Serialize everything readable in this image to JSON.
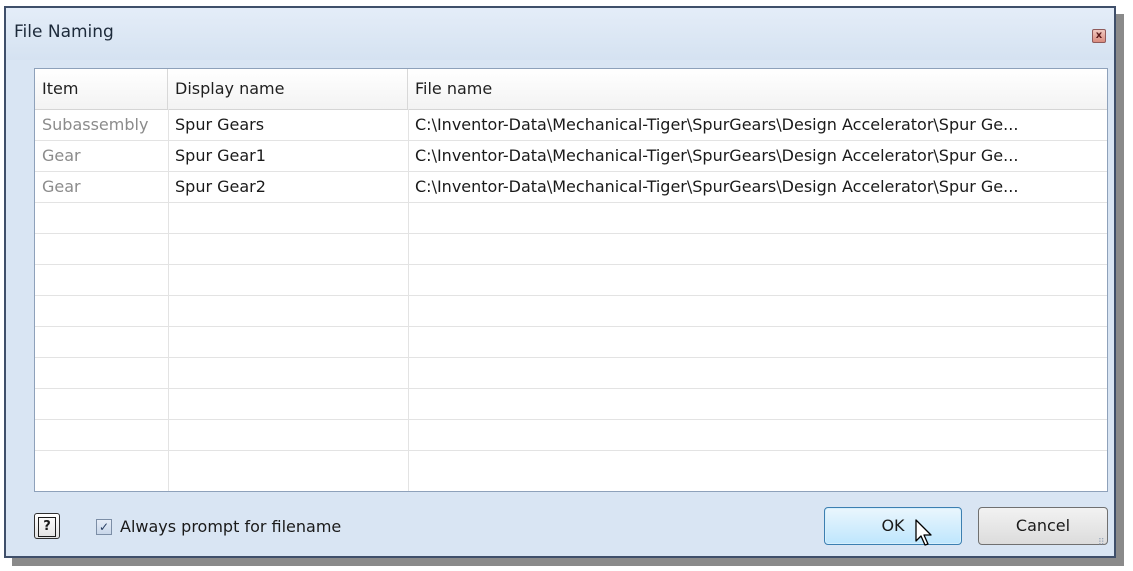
{
  "dialog": {
    "title": "File Naming",
    "close_label": "x"
  },
  "table": {
    "columns": [
      "Item",
      "Display name",
      "File name"
    ],
    "rows": [
      {
        "item": "Subassembly",
        "display_name": "Spur Gears",
        "file_name": "C:\\Inventor-Data\\Mechanical-Tiger\\SpurGears\\Design Accelerator\\Spur Ge..."
      },
      {
        "item": "Gear",
        "display_name": "Spur Gear1",
        "file_name": "C:\\Inventor-Data\\Mechanical-Tiger\\SpurGears\\Design Accelerator\\Spur Ge..."
      },
      {
        "item": "Gear",
        "display_name": "Spur Gear2",
        "file_name": "C:\\Inventor-Data\\Mechanical-Tiger\\SpurGears\\Design Accelerator\\Spur Ge..."
      }
    ],
    "empty_row_count": 8
  },
  "footer": {
    "help_label": "?",
    "checkbox_checked": true,
    "checkbox_label": "Always prompt for filename",
    "ok_label": "OK",
    "cancel_label": "Cancel"
  },
  "icons": {
    "close": "close-icon",
    "help": "help-icon",
    "cursor": "mouse-pointer-icon"
  }
}
